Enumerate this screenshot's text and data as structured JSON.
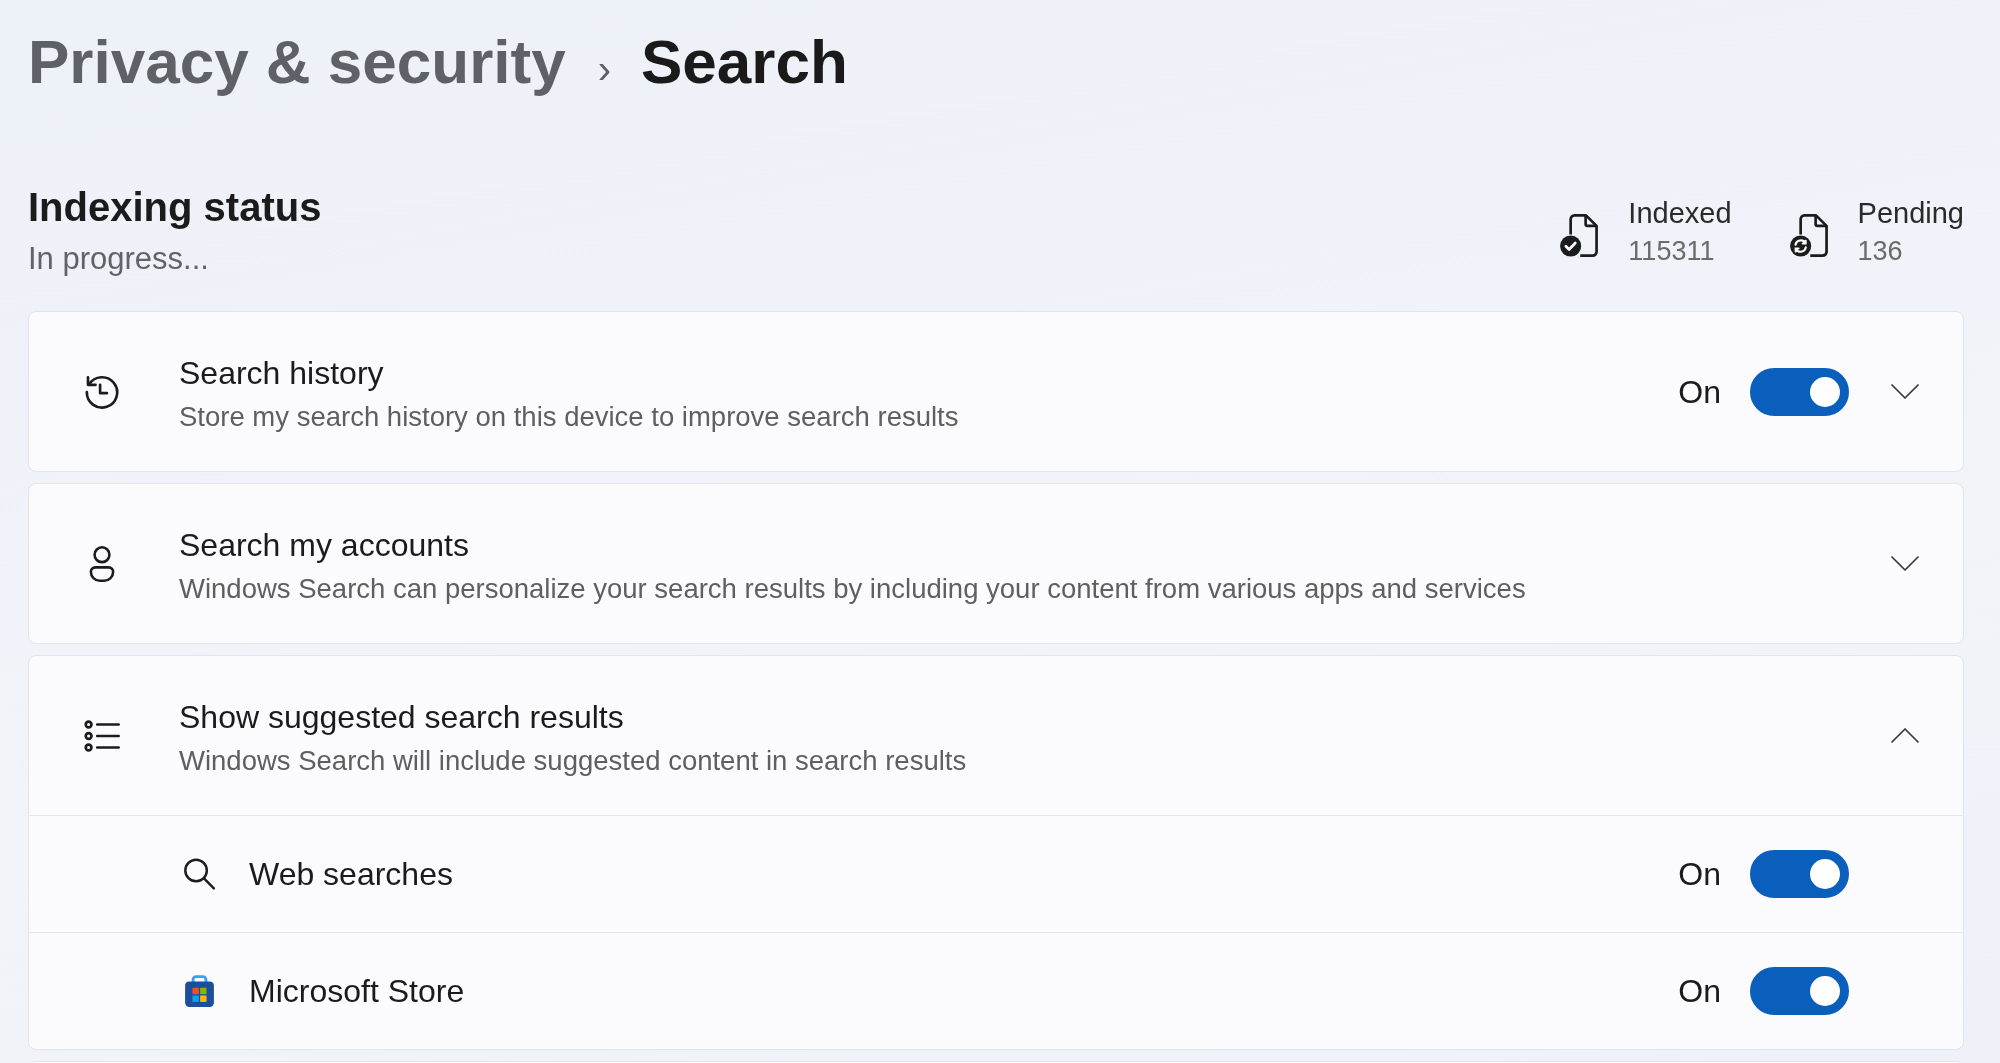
{
  "breadcrumb": {
    "parent": "Privacy & security",
    "separator": "›",
    "current": "Search"
  },
  "indexing": {
    "title": "Indexing status",
    "status": "In progress...",
    "stats": [
      {
        "kind": "indexed",
        "label": "Indexed",
        "value": "115311"
      },
      {
        "kind": "pending",
        "label": "Pending",
        "value": "136"
      }
    ]
  },
  "settings": [
    {
      "kind": "history",
      "title": "Search history",
      "description": "Store my search history on this device to improve search results",
      "toggle": {
        "label": "On",
        "on": true
      },
      "expanded": false
    },
    {
      "kind": "accounts",
      "title": "Search my accounts",
      "description": "Windows Search can personalize your search results by including your content from various apps and services",
      "expanded": false
    },
    {
      "kind": "suggestions",
      "title": "Show suggested search results",
      "description": "Windows Search will include suggested content in search results",
      "expanded": true,
      "children": [
        {
          "kind": "web",
          "label": "Web searches",
          "toggle": {
            "label": "On",
            "on": true
          }
        },
        {
          "kind": "store",
          "label": "Microsoft Store",
          "toggle": {
            "label": "On",
            "on": true
          }
        }
      ]
    }
  ]
}
